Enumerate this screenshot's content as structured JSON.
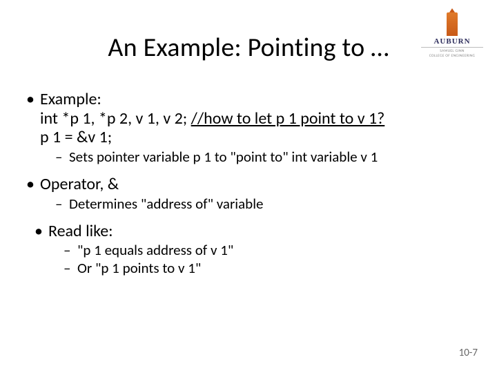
{
  "title": "An Example: Pointing to …",
  "logo": {
    "uni": "AUBURN",
    "sub1": "SAMUEL GINN",
    "sub2": "COLLEGE OF ENGINEERING"
  },
  "bullets": {
    "b1": {
      "head": "Example:",
      "line1_a": "int *p 1, *p 2, v 1, v 2; ",
      "line1_b": "//how to let p 1 point to v 1?",
      "line2": "p 1 = &v 1;",
      "sub1": "Sets pointer variable p 1 to \"point to\" int variable v 1"
    },
    "b2": {
      "head": "Operator, &",
      "sub1": "Determines \"address of\" variable"
    },
    "b3": {
      "head": "Read like:",
      "sub1": "\"p 1 equals address of v 1\"",
      "sub2": "Or \"p 1 points to v 1\""
    }
  },
  "footer": "10-7"
}
